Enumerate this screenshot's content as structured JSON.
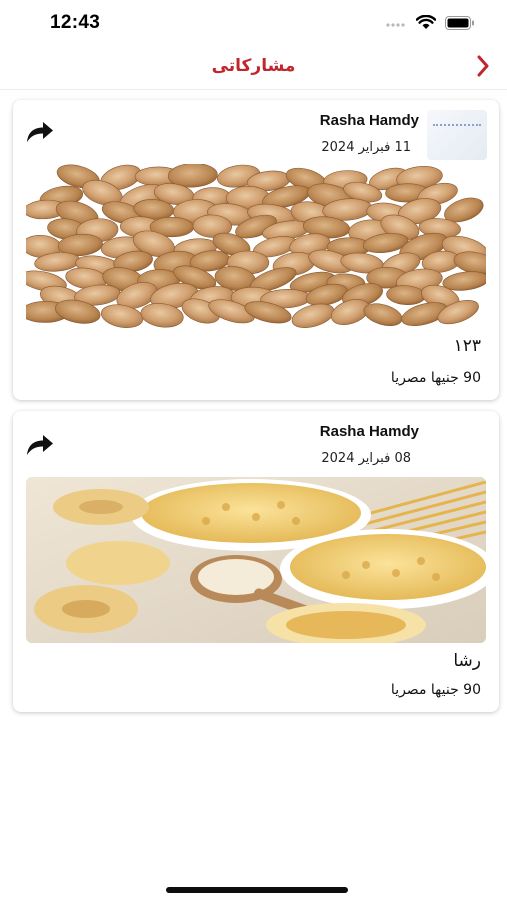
{
  "status_bar": {
    "time": "12:43",
    "icons": [
      "cellular-signal-icon",
      "wifi-icon",
      "battery-icon"
    ]
  },
  "nav": {
    "title": "مشاركاتى",
    "back_icon": "chevron-right-icon",
    "accent_color": "#c0272d"
  },
  "posts": [
    {
      "author": "Rasha Hamdy",
      "date": "11 فبراير 2024",
      "title": "١٢٣",
      "price": "90 جنيها مصريا",
      "image": "fava-beans-photo",
      "share_icon": "share-arrow-icon"
    },
    {
      "author": "Rasha Hamdy",
      "date": "08 فبراير 2024",
      "title": "رشا",
      "price": "90 جنيها مصريا",
      "image": "pasta-assortment-photo",
      "share_icon": "share-arrow-icon"
    }
  ]
}
